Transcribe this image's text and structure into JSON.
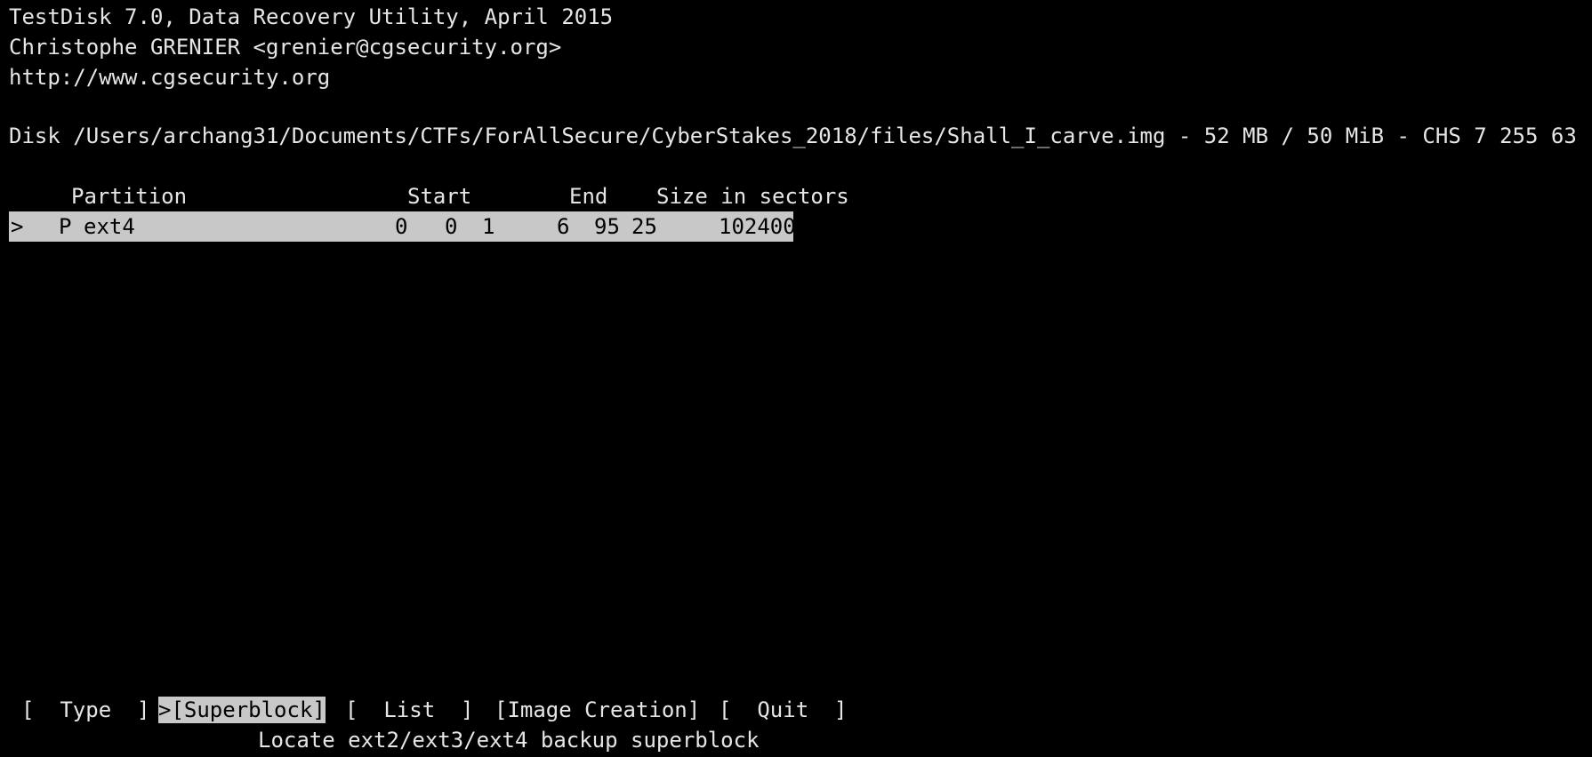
{
  "colors": {
    "background": "#000000",
    "foreground": "#e6e6e6",
    "highlight": "#c8c8c8",
    "highlight_text": "#000000"
  },
  "header": {
    "title_line": "TestDisk 7.0, Data Recovery Utility, April 2015",
    "author_line": "Christophe GRENIER <grenier@cgsecurity.org>",
    "url_line": "http://www.cgsecurity.org"
  },
  "disk": {
    "info_line": "Disk /Users/archang31/Documents/CTFs/ForAllSecure/CyberStakes_2018/files/Shall_I_carve.img - 52 MB / 50 MiB - CHS 7 255 63"
  },
  "table": {
    "headers": {
      "partition": "Partition",
      "start": "Start",
      "end": "End",
      "size": "Size in sectors"
    },
    "rows": [
      {
        "cursor": ">",
        "flag": "P",
        "type": "ext4",
        "start_c": "0",
        "start_h": "0",
        "start_s": "1",
        "end_c": "6",
        "end_h": "95",
        "end_s": "25",
        "size": "102400"
      }
    ]
  },
  "menu": {
    "items": [
      {
        "label": "[  Type  ]",
        "selected": false
      },
      {
        "label": ">[Superblock]",
        "selected": true
      },
      {
        "label": "[  List  ]",
        "selected": false
      },
      {
        "label": "[Image Creation]",
        "selected": false
      },
      {
        "label": "[  Quit  ]",
        "selected": false
      }
    ],
    "hint": "Locate ext2/ext3/ext4 backup superblock"
  }
}
